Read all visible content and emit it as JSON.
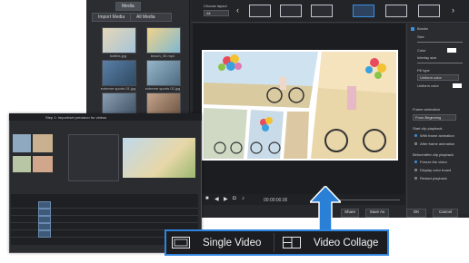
{
  "media": {
    "tabs": [
      "Media",
      "Import Media",
      "All Media"
    ],
    "files": [
      "bottles.jpg",
      "beach_06.mp4",
      "extreme sports 01.jpg",
      "extreme sports 02.jpg",
      "extreme sports 03.jpg",
      "extreme sports 04.jpg"
    ]
  },
  "layout": {
    "label": "Choose layout",
    "select": "All"
  },
  "properties": {
    "border": "Border",
    "size": "Size",
    "color": "Color",
    "interlay": "Interlay size",
    "fill_type": "Fill type",
    "fill_value": "Uniform color",
    "uniform": "Uniform color",
    "frame_anim": "Frame animation",
    "frame_value": "From Beginning",
    "start_play": "Start clip playback",
    "opt1": "With frame animation",
    "opt2": "After frame animation",
    "before_after": "Before/after clip playback",
    "opt3": "Freeze the video",
    "opt4": "Display color board",
    "opt5": "Restart playback",
    "btn_share": "Share",
    "btn_save": "Save As",
    "btn_ok": "OK",
    "btn_cancel": "Cancel"
  },
  "transport": {
    "time": "00:00:00.00"
  },
  "win2": {
    "title": "Step 1: Import/set precision for videos"
  },
  "bottom": {
    "single": "Single Video",
    "collage": "Video Collage"
  },
  "colors": {
    "accent": "#2f86e0",
    "arrow": "#2a7fd6",
    "dark_bg": "#26282c"
  }
}
